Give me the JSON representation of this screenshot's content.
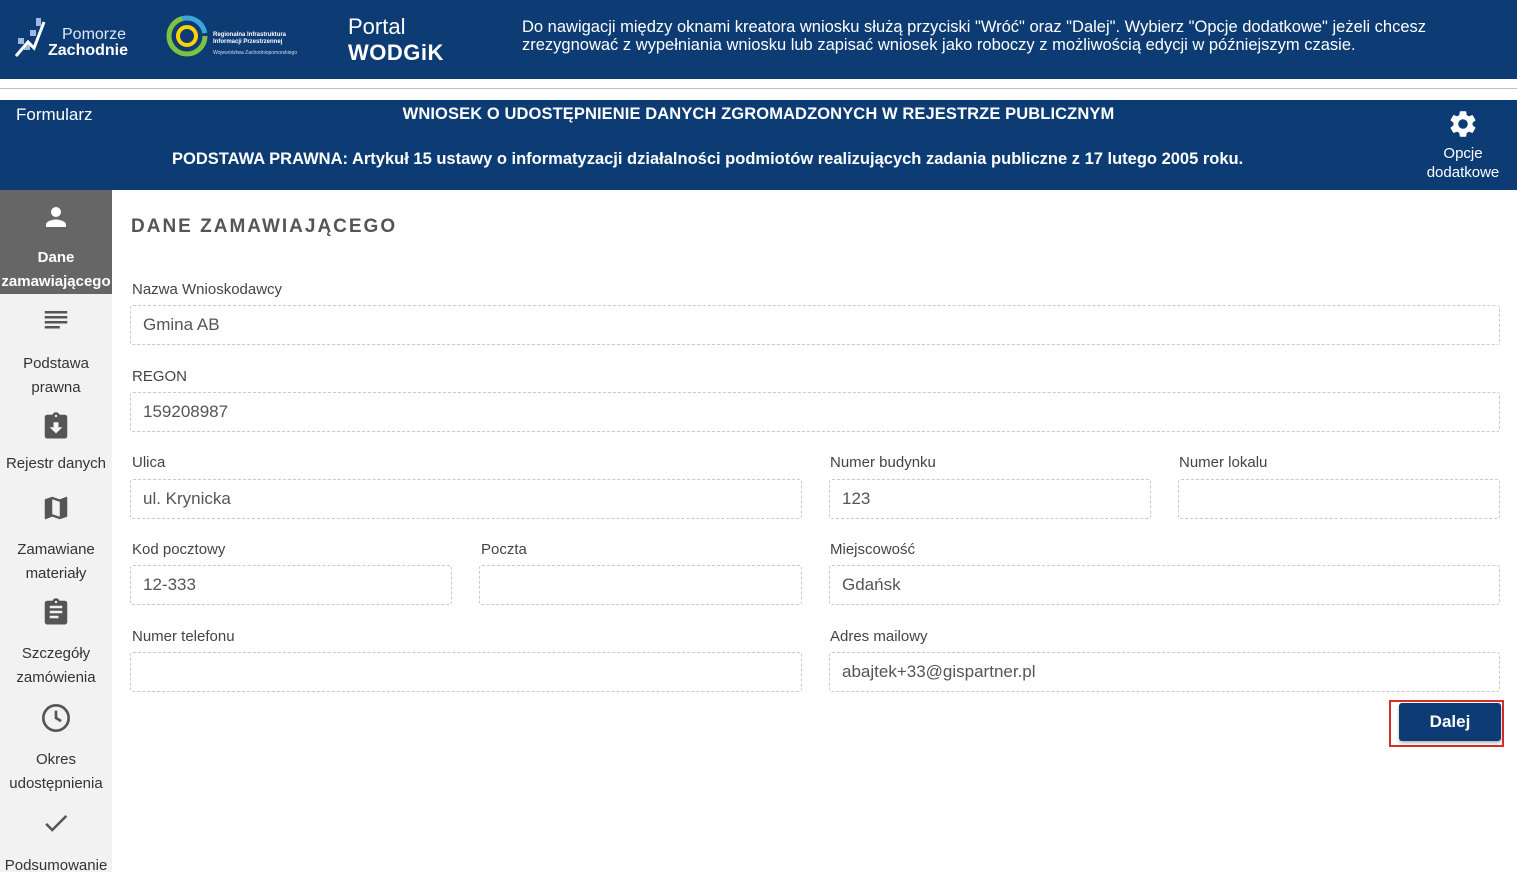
{
  "header": {
    "logo1_line1": "Pomorze",
    "logo1_line2": "Zachodnie",
    "logo2_line1": "Regionalna Infrastruktura",
    "logo2_line2": "Informacji Przestrzennej",
    "logo2_line3": "Województwa Zachodniopomorskiego",
    "portal_line1": "Portal",
    "portal_line2": "WODGiK",
    "note": "Do nawigacji między oknami kreatora wniosku służą przyciski \"Wróć\" oraz \"Dalej\". Wybierz \"Opcje dodatkowe\" jeżeli chcesz zrezygnować z wypełniania wniosku lub zapisać wniosek jako roboczy z możliwością edycji w późniejszym czasie."
  },
  "form_header": {
    "label": "Formularz",
    "title": "WNIOSEK O UDOSTĘPNIENIE DANYCH ZGROMADZONYCH W REJESTRZE PUBLICZNYM",
    "legal": "PODSTAWA PRAWNA: Artykuł 15 ustawy o informatyzacji działalności podmiotów realizujących zadania publiczne z 17 lutego 2005 roku.",
    "options_line1": "Opcje",
    "options_line2": "dodatkowe"
  },
  "sidebar": {
    "steps": [
      {
        "line1": "Dane",
        "line2": "zamawiającego",
        "icon": "person-icon"
      },
      {
        "line1": "Podstawa",
        "line2": "prawna",
        "icon": "lines-icon"
      },
      {
        "line1": "Rejestr danych",
        "line2": "",
        "icon": "clipboard-download-icon"
      },
      {
        "line1": "Zamawiane",
        "line2": "materiały",
        "icon": "map-icon"
      },
      {
        "line1": "Szczegóły",
        "line2": "zamówienia",
        "icon": "clipboard-icon"
      },
      {
        "line1": "Okres",
        "line2": "udostępnienia",
        "icon": "clock-icon"
      },
      {
        "line1": "Podsumowanie",
        "line2": "",
        "icon": "check-icon"
      }
    ]
  },
  "main": {
    "section_title": "DANE ZAMAWIAJĄCEGO",
    "fields": {
      "nazwa": {
        "label": "Nazwa Wnioskodawcy",
        "value": "Gmina AB"
      },
      "regon": {
        "label": "REGON",
        "value": "159208987"
      },
      "ulica": {
        "label": "Ulica",
        "value": "ul. Krynicka"
      },
      "numer_budynku": {
        "label": "Numer budynku",
        "value": "123"
      },
      "numer_lokalu": {
        "label": "Numer lokalu",
        "value": ""
      },
      "kod_pocztowy": {
        "label": "Kod pocztowy",
        "value": "12-333"
      },
      "poczta": {
        "label": "Poczta",
        "value": ""
      },
      "miejscowosc": {
        "label": "Miejscowość",
        "value": "Gdańsk"
      },
      "telefon": {
        "label": "Numer telefonu",
        "value": ""
      },
      "email": {
        "label": "Adres mailowy",
        "value": "abajtek+33@gispartner.pl"
      }
    },
    "next_button": "Dalej"
  },
  "colors": {
    "brand_blue": "#0d3c75",
    "active_step": "#666666",
    "highlight_red": "#d62c2c"
  }
}
